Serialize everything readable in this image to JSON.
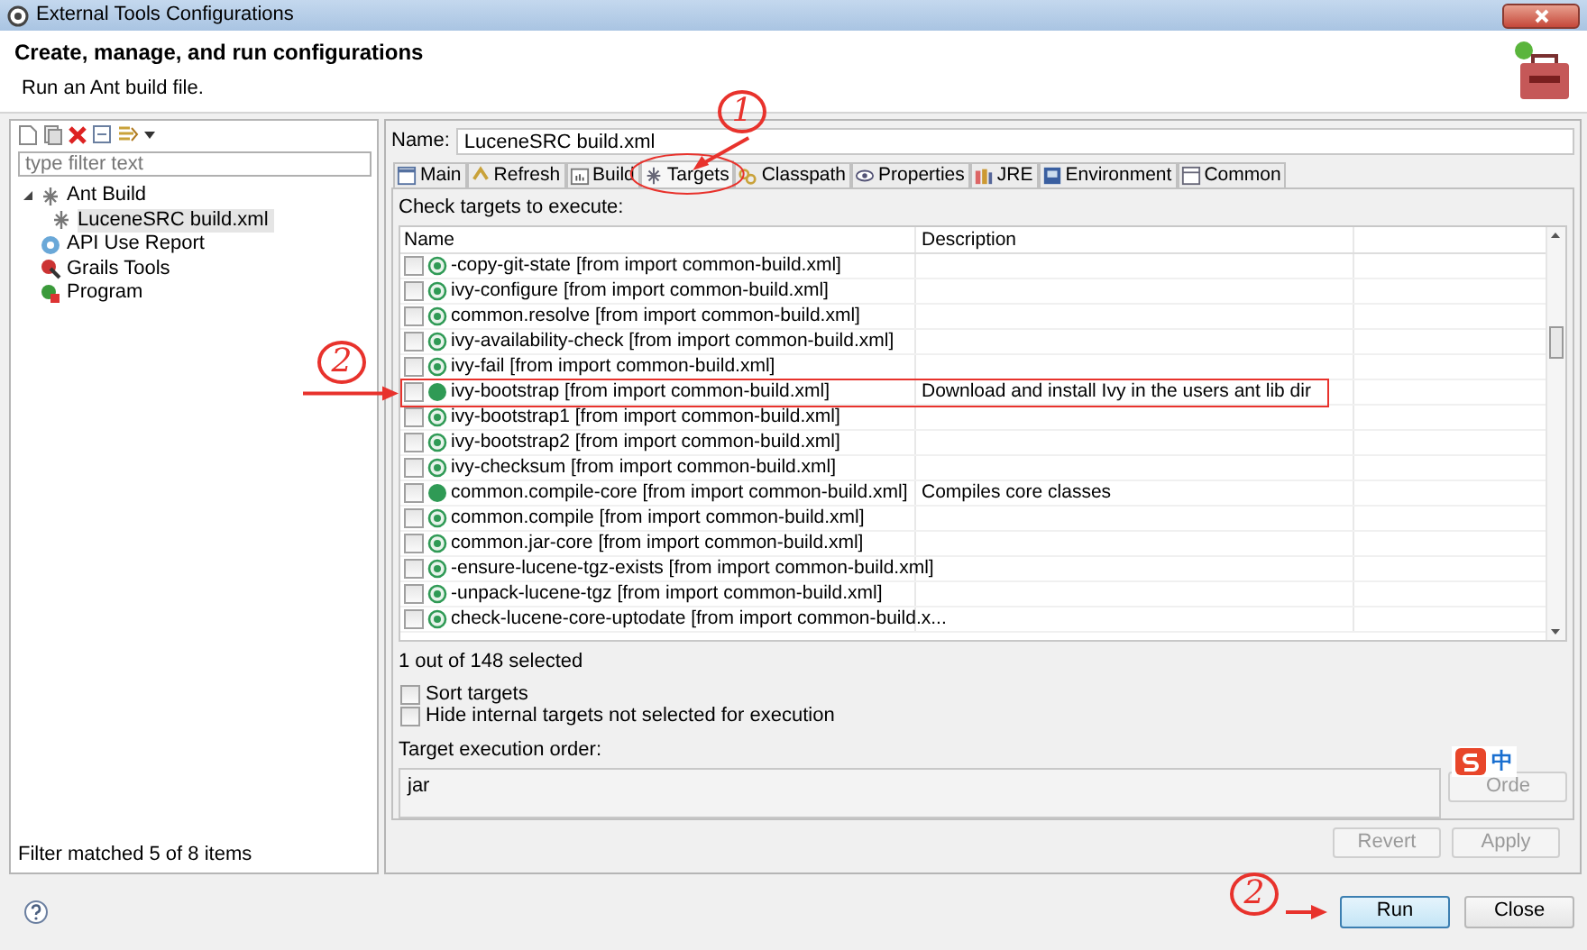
{
  "window": {
    "title": "External Tools Configurations"
  },
  "header": {
    "title": "Create, manage, and run configurations",
    "subtitle": "Run an Ant build file."
  },
  "sidebar": {
    "filter": {
      "placeholder": "type filter text"
    },
    "tree": [
      {
        "label": "Ant Build",
        "kind": "ant",
        "expanded": true,
        "selected": false,
        "children": [
          {
            "label": "LuceneSRC build.xml",
            "kind": "ant",
            "selected": true
          }
        ]
      },
      {
        "label": "API Use Report",
        "kind": "api",
        "selected": false
      },
      {
        "label": "Grails Tools",
        "kind": "grails",
        "selected": false
      },
      {
        "label": "Program",
        "kind": "program",
        "selected": false
      }
    ],
    "status": "Filter matched 5 of 8 items"
  },
  "name": {
    "label": "Name:",
    "value": "LuceneSRC build.xml"
  },
  "tabs": [
    {
      "label": "Main",
      "kind": "main",
      "selected": false
    },
    {
      "label": "Refresh",
      "kind": "refresh",
      "selected": false
    },
    {
      "label": "Build",
      "kind": "build",
      "selected": false
    },
    {
      "label": "Targets",
      "kind": "targets",
      "selected": true
    },
    {
      "label": "Classpath",
      "kind": "classpath",
      "selected": false
    },
    {
      "label": "Properties",
      "kind": "properties",
      "selected": false
    },
    {
      "label": "JRE",
      "kind": "jre",
      "selected": false
    },
    {
      "label": "Environment",
      "kind": "environment",
      "selected": false
    },
    {
      "label": "Common",
      "kind": "common",
      "selected": false
    }
  ],
  "targets": {
    "prompt": "Check targets to execute:",
    "columns": [
      "Name",
      "Description"
    ],
    "rows": [
      {
        "name": "-copy-git-state [from import common-build.xml]",
        "kind": "internal",
        "checked": false
      },
      {
        "name": "ivy-configure [from import common-build.xml]",
        "kind": "internal",
        "checked": false
      },
      {
        "name": "common.resolve [from import common-build.xml]",
        "kind": "internal",
        "checked": false
      },
      {
        "name": "ivy-availability-check [from import common-build.xml]",
        "kind": "internal",
        "checked": false
      },
      {
        "name": "ivy-fail [from import common-build.xml]",
        "kind": "internal",
        "checked": false
      },
      {
        "name": "ivy-bootstrap [from import common-build.xml]",
        "kind": "public",
        "checked": false,
        "highlighted": true,
        "description": "Download and install Ivy in the users ant lib dir"
      },
      {
        "name": "ivy-bootstrap1 [from import common-build.xml]",
        "kind": "internal",
        "checked": false
      },
      {
        "name": "ivy-bootstrap2 [from import common-build.xml]",
        "kind": "internal",
        "checked": false
      },
      {
        "name": "ivy-checksum [from import common-build.xml]",
        "kind": "internal",
        "checked": false
      },
      {
        "name": "common.compile-core [from import common-build.xml]",
        "kind": "public",
        "checked": false,
        "description": "Compiles core classes"
      },
      {
        "name": "common.compile [from import common-build.xml]",
        "kind": "internal",
        "checked": false
      },
      {
        "name": "common.jar-core [from import common-build.xml]",
        "kind": "internal",
        "checked": false
      },
      {
        "name": "-ensure-lucene-tgz-exists [from import common-build.xml]",
        "kind": "internal",
        "checked": false
      },
      {
        "name": "-unpack-lucene-tgz [from import common-build.xml]",
        "kind": "internal",
        "checked": false
      },
      {
        "name": "check-lucene-core-uptodate [from import common-build.x...",
        "kind": "internal",
        "checked": false
      }
    ],
    "summary": "1 out of 148 selected"
  },
  "options": [
    {
      "label": "Sort targets",
      "checked": false
    },
    {
      "label": "Hide internal targets not selected for execution",
      "checked": false
    }
  ],
  "order": {
    "label": "Target execution order:",
    "value": "jar",
    "button": {
      "label": "Orde",
      "disabled": true
    }
  },
  "actions": [
    {
      "label": "Revert",
      "disabled": true
    },
    {
      "label": "Apply",
      "disabled": true
    }
  ],
  "footer_buttons": [
    {
      "label": "Run",
      "default": true
    },
    {
      "label": "Close",
      "default": false
    }
  ],
  "ime": {
    "label": "中"
  },
  "annotations": [
    {
      "label": "1"
    },
    {
      "label": "2"
    },
    {
      "label": "2"
    }
  ]
}
